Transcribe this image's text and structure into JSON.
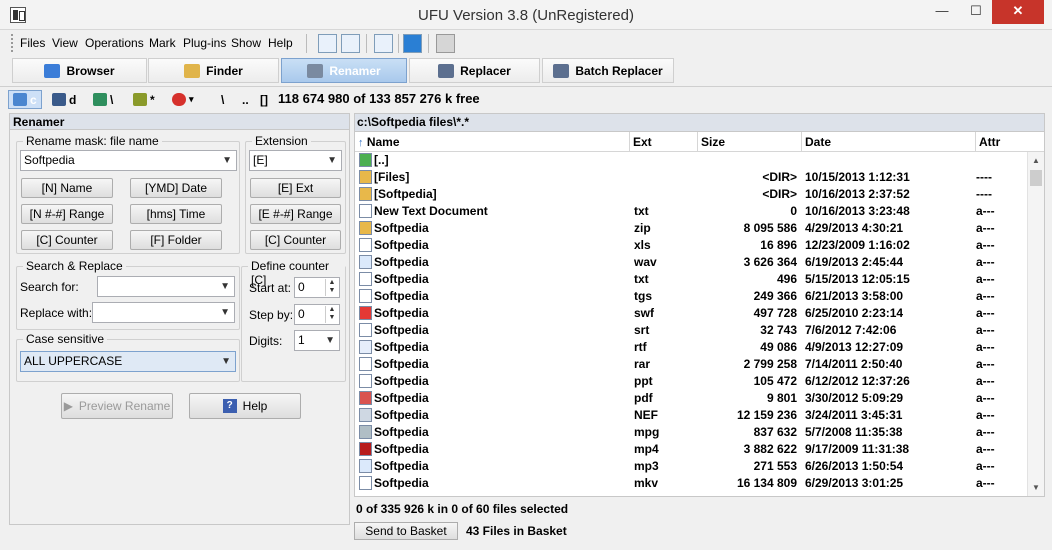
{
  "window": {
    "title": "UFU Version 3.8 (UnRegistered)",
    "min": "—",
    "max": "☐",
    "close": "✕"
  },
  "menu": [
    "Files",
    "View",
    "Operations",
    "Mark",
    "Plug-ins",
    "Show",
    "Help"
  ],
  "tabs": [
    {
      "label": "Browser",
      "icon": "browser-icon"
    },
    {
      "label": "Finder",
      "icon": "finder-icon"
    },
    {
      "label": "Renamer",
      "icon": "renamer-icon",
      "active": true
    },
    {
      "label": "Replacer",
      "icon": "replacer-icon"
    },
    {
      "label": "Batch Replacer",
      "icon": "batch-replacer-icon"
    }
  ],
  "drives": [
    {
      "label": "c",
      "active": true
    },
    {
      "label": "d"
    },
    {
      "label": "\\"
    },
    {
      "label": "*"
    },
    {
      "label": "▾"
    }
  ],
  "path_buttons": [
    "\\",
    "..",
    "[]"
  ],
  "free_space": "118 674 980 of 133 857 276 k free",
  "renamer": {
    "title": "Renamer",
    "rename_mask_label": "Rename mask: file name",
    "rename_mask_value": "Softpedia",
    "extension_label": "Extension",
    "extension_value": "[E]",
    "mask_buttons": {
      "name": "[N] Name",
      "ymd": "[YMD] Date",
      "range": "[N #-#] Range",
      "time": "[hms] Time",
      "counter": "[C] Counter",
      "folder": "[F] Folder"
    },
    "ext_buttons": {
      "ext": "[E] Ext",
      "range": "[E #-#] Range",
      "counter": "[C] Counter"
    },
    "search_replace_label": "Search & Replace",
    "search_for_label": "Search for:",
    "replace_with_label": "Replace with:",
    "define_counter_label": "Define counter [C]",
    "start_at_label": "Start at:",
    "start_at_value": "0",
    "step_by_label": "Step by:",
    "step_by_value": "0",
    "digits_label": "Digits:",
    "digits_value": "1",
    "case_label": "Case sensitive",
    "case_value": "ALL UPPERCASE",
    "preview_button": "Preview Rename",
    "help_button": "Help"
  },
  "file_panel": {
    "path": "c:\\Softpedia files\\*.*",
    "columns": {
      "name": "Name",
      "ext": "Ext",
      "size": "Size",
      "date": "Date",
      "attr": "Attr"
    },
    "rows": [
      {
        "name": "[..]",
        "ext": "",
        "size": "",
        "date": "",
        "attr": "",
        "icon": "up-folder-icon"
      },
      {
        "name": "[Files]",
        "ext": "",
        "size": "<DIR>",
        "date": "10/15/2013 1:12:31",
        "attr": "----",
        "icon": "folder-icon"
      },
      {
        "name": "[Softpedia]",
        "ext": "",
        "size": "<DIR>",
        "date": "10/16/2013 2:37:52",
        "attr": "----",
        "icon": "folder-icon"
      },
      {
        "name": "New Text Document",
        "ext": "txt",
        "size": "0",
        "date": "10/16/2013 3:23:48",
        "attr": "a---",
        "icon": "text-file-icon"
      },
      {
        "name": "Softpedia",
        "ext": "zip",
        "size": "8 095 586",
        "date": "4/29/2013 4:30:21",
        "attr": "a---",
        "icon": "zip-file-icon"
      },
      {
        "name": "Softpedia",
        "ext": "xls",
        "size": "16 896",
        "date": "12/23/2009 1:16:02",
        "attr": "a---",
        "icon": "file-icon"
      },
      {
        "name": "Softpedia",
        "ext": "wav",
        "size": "3 626 364",
        "date": "6/19/2013 2:45:44",
        "attr": "a---",
        "icon": "audio-file-icon"
      },
      {
        "name": "Softpedia",
        "ext": "txt",
        "size": "496",
        "date": "5/15/2013 12:05:15",
        "attr": "a---",
        "icon": "text-file-icon"
      },
      {
        "name": "Softpedia",
        "ext": "tgs",
        "size": "249 366",
        "date": "6/21/2013 3:58:00",
        "attr": "a---",
        "icon": "file-icon"
      },
      {
        "name": "Softpedia",
        "ext": "swf",
        "size": "497 728",
        "date": "6/25/2010 2:23:14",
        "attr": "a---",
        "icon": "flash-file-icon"
      },
      {
        "name": "Softpedia",
        "ext": "srt",
        "size": "32 743",
        "date": "7/6/2012 7:42:06",
        "attr": "a---",
        "icon": "file-icon"
      },
      {
        "name": "Softpedia",
        "ext": "rtf",
        "size": "49 086",
        "date": "4/9/2013 12:27:09",
        "attr": "a---",
        "icon": "rtf-file-icon"
      },
      {
        "name": "Softpedia",
        "ext": "rar",
        "size": "2 799 258",
        "date": "7/14/2011 2:50:40",
        "attr": "a---",
        "icon": "file-icon"
      },
      {
        "name": "Softpedia",
        "ext": "ppt",
        "size": "105 472",
        "date": "6/12/2012 12:37:26",
        "attr": "a---",
        "icon": "file-icon"
      },
      {
        "name": "Softpedia",
        "ext": "pdf",
        "size": "9 801",
        "date": "3/30/2012 5:09:29",
        "attr": "a---",
        "icon": "pdf-file-icon"
      },
      {
        "name": "Softpedia",
        "ext": "NEF",
        "size": "12 159 236",
        "date": "3/24/2011 3:45:31",
        "attr": "a---",
        "icon": "image-file-icon"
      },
      {
        "name": "Softpedia",
        "ext": "mpg",
        "size": "837 632",
        "date": "5/7/2008 11:35:38",
        "attr": "a---",
        "icon": "video-file-icon"
      },
      {
        "name": "Softpedia",
        "ext": "mp4",
        "size": "3 882 622",
        "date": "9/17/2009 11:31:38",
        "attr": "a---",
        "icon": "mp4-file-icon"
      },
      {
        "name": "Softpedia",
        "ext": "mp3",
        "size": "271 553",
        "date": "6/26/2013 1:50:54",
        "attr": "a---",
        "icon": "audio-file-icon"
      },
      {
        "name": "Softpedia",
        "ext": "mkv",
        "size": "16 134 809",
        "date": "6/29/2013 3:01:25",
        "attr": "a---",
        "icon": "file-icon"
      }
    ]
  },
  "status": "0 of 335 926 k in 0 of 60 files selected",
  "basket": {
    "button": "Send to Basket",
    "count": "43 Files in Basket"
  },
  "colors": {
    "active_tab": "#a9c9ec",
    "panel_header": "#dde2ea",
    "close_button": "#c7342a"
  }
}
